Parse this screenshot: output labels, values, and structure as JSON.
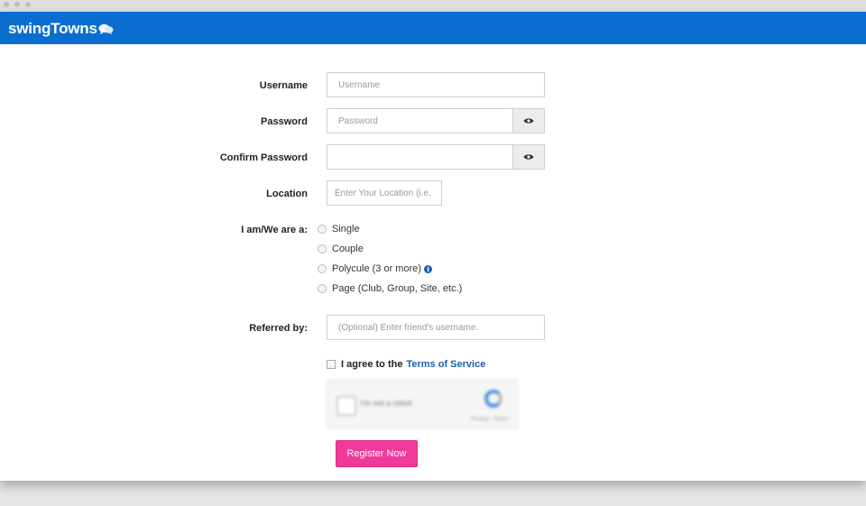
{
  "brand": {
    "name": "swingTowns",
    "accent": "#0a6ed1"
  },
  "form": {
    "username": {
      "label": "Username",
      "placeholder": "Username"
    },
    "password": {
      "label": "Password",
      "placeholder": "Password"
    },
    "confirm_password": {
      "label": "Confirm Password",
      "placeholder": ""
    },
    "location": {
      "label": "Location",
      "placeholder": "Enter Your Location (i.e."
    },
    "type": {
      "label": "I am/We are a:",
      "options": [
        "Single",
        "Couple",
        "Polycule (3 or more)",
        "Page (Club, Group, Site, etc.)"
      ]
    },
    "referred": {
      "label": "Referred by:",
      "placeholder": "(Optional) Enter friend's username."
    },
    "agree": {
      "prefix": "I agree to the",
      "link": "Terms of Service"
    },
    "captcha": {
      "text": "I'm not a robot",
      "footer": "Privacy - Terms"
    },
    "register_label": "Register Now"
  },
  "colors": {
    "button": "#ee3a9a",
    "link": "#1a5fb4"
  }
}
